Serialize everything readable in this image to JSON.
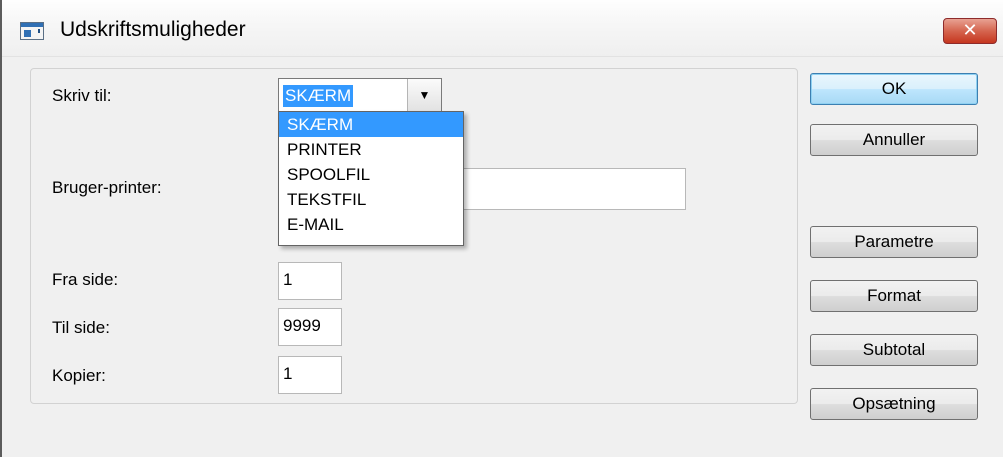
{
  "window": {
    "title": "Udskriftsmuligheder",
    "close_glyph": "✕"
  },
  "form": {
    "print_to_label": "Skriv til:",
    "print_to_value": "SKÆRM",
    "user_printer_label": "Bruger-printer:",
    "user_printer_value": "",
    "from_page_label": "Fra side:",
    "from_page_value": "1",
    "to_page_label": "Til side:",
    "to_page_value": "9999",
    "copies_label": "Kopier:",
    "copies_value": "1"
  },
  "dropdown": {
    "options": [
      "SKÆRM",
      "PRINTER",
      "SPOOLFIL",
      "TEKSTFIL",
      "E-MAIL"
    ],
    "selected_index": 0
  },
  "buttons": {
    "ok": "OK",
    "cancel": "Annuller",
    "parameters": "Parametre",
    "format": "Format",
    "subtotal": "Subtotal",
    "setup": "Opsætning"
  },
  "icons": {
    "app": "app-window-icon",
    "close": "close-icon",
    "dropdown_arrow": "chevron-down-icon"
  },
  "colors": {
    "selection": "#3399ff",
    "close_button": "#c5361f"
  }
}
